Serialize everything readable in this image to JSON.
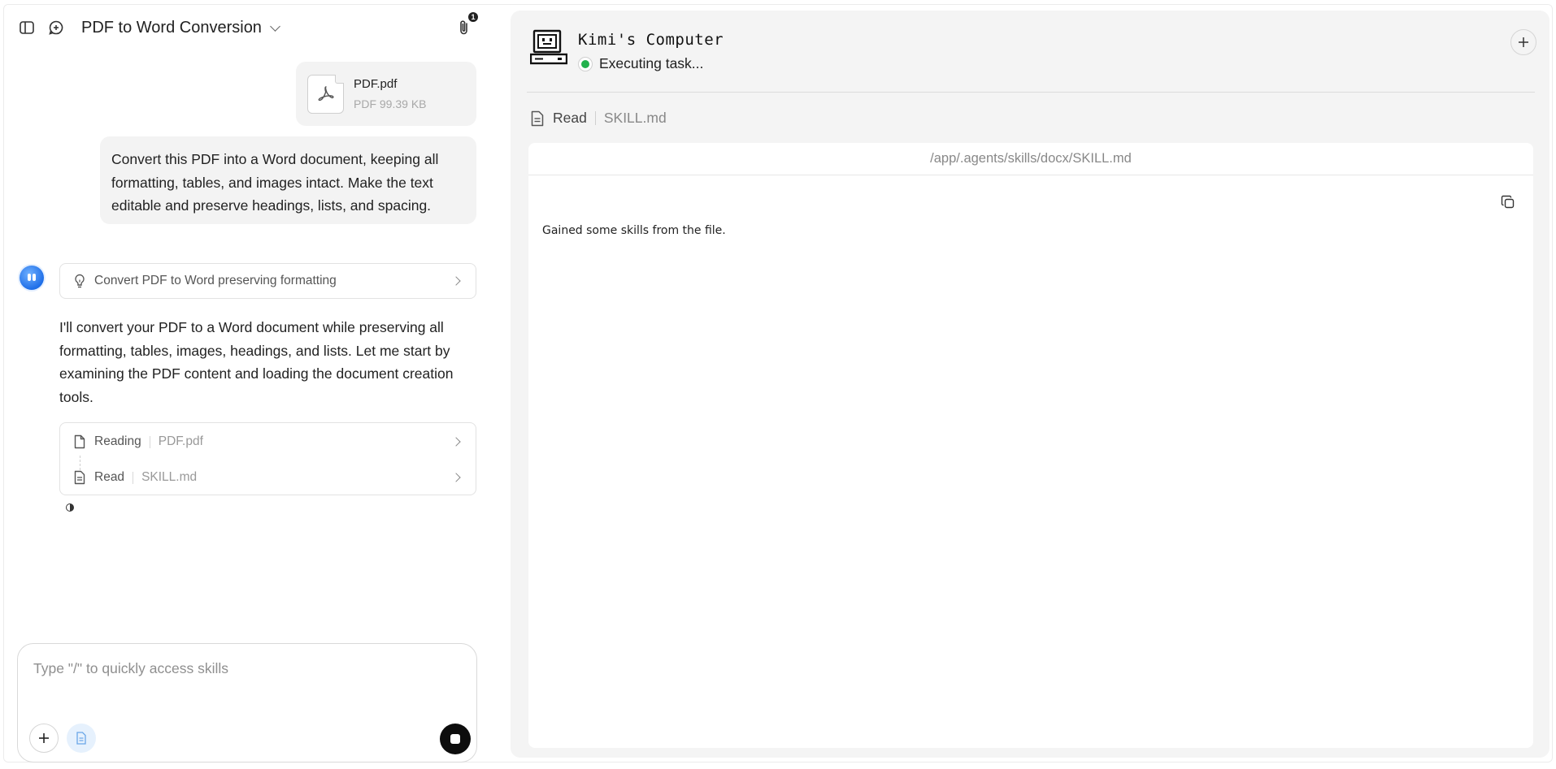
{
  "header": {
    "title": "PDF to Word Conversion",
    "attachments_count": "1"
  },
  "attachment": {
    "file_name": "PDF.pdf",
    "file_meta": "PDF 99.39 KB"
  },
  "user_message": "Convert this PDF into a Word document, keeping all formatting, tables, and images intact. Make the text editable and preserve headings, lists, and spacing.",
  "assistant": {
    "thought_summary": "Convert PDF to Word preserving formatting",
    "message": "I'll convert your PDF to a Word document while preserving all formatting, tables, images, headings, and lists. Let me start by examining the PDF content and loading the document creation tools.",
    "steps": [
      {
        "label": "Reading",
        "value": "PDF.pdf",
        "icon": "file-icon"
      },
      {
        "label": "Read",
        "value": "SKILL.md",
        "icon": "document-icon"
      }
    ]
  },
  "composer": {
    "placeholder": "Type \"/\" to quickly access skills"
  },
  "computer": {
    "title": "Kimi's Computer",
    "status": "Executing task...",
    "status_color": "#22b14c",
    "action_label": "Read",
    "action_file": "SKILL.md",
    "viewer_path": "/app/.agents/skills/docx/SKILL.md",
    "viewer_text": "Gained some skills from the file."
  },
  "colors": {
    "bubble_bg": "#f3f3f3",
    "panel_bg": "#f4f4f4",
    "avatar_blue": "#1f6fe8",
    "stop_button": "#0d0d0d"
  }
}
